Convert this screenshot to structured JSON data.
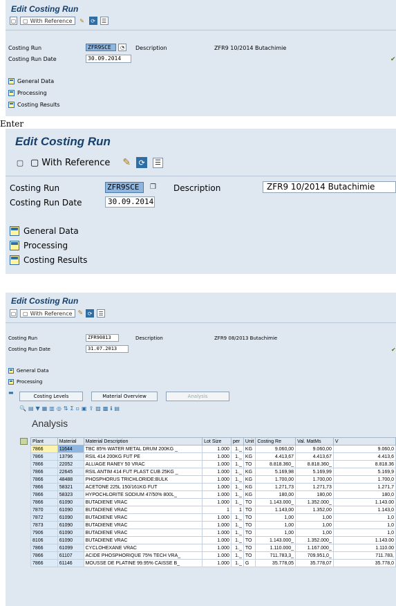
{
  "p1": {
    "title": "Edit Costing Run",
    "tb_ref": "With Reference",
    "run_lbl": "Costing Run",
    "run_val": "ZFR9SCE",
    "desc_lbl": "Description",
    "desc_val": "ZFR9 10/2014 Butachimie",
    "date_lbl": "Costing Run Date",
    "date_val": "30.09.2014",
    "sections": [
      "General Data",
      "Processing",
      "Costing Results"
    ]
  },
  "enter": "Enter",
  "p2": {
    "title": "Edit Costing Run",
    "tb_ref": "With Reference",
    "run_lbl": "Costing Run",
    "run_val": "ZFR9SCE",
    "desc_lbl": "Description",
    "desc_val": "ZFR9 10/2014 Butachimie",
    "date_lbl": "Costing Run Date",
    "date_val": "30.09.2014",
    "sections": [
      "General Data",
      "Processing",
      "Costing Results"
    ]
  },
  "p3": {
    "title": "Edit Costing Run",
    "tb_ref": "With Reference",
    "run_lbl": "Costing Run",
    "run_val": "ZFR90813",
    "desc_lbl": "Description",
    "desc_val": "ZFR9 08/2013 Butachimie",
    "date_lbl": "Costing Run Date",
    "date_val": "31.07.2013",
    "sections": [
      "General Data",
      "Processing"
    ],
    "tabs": [
      "Costing Levels",
      "Material Overview",
      "Analysis"
    ],
    "analysis_title": "Analysis",
    "columns": [
      "Plant",
      "Material",
      "Material Description",
      "Lot Size",
      "per",
      "Unit",
      "Costing Re",
      "Val. MatMs",
      "V"
    ],
    "rows": [
      [
        "7866",
        "11644",
        "TBC 85% WATER METAL DRUM 200KG _",
        "1.000",
        "1._",
        "KG",
        "9.060,00",
        "9.060,00",
        "9.060,0"
      ],
      [
        "7866",
        "13796",
        "RSIL 414 200KG FUT PE",
        "1.000",
        "1._",
        "KG",
        "4.413,67",
        "4.413,67",
        "4.413,6"
      ],
      [
        "7866",
        "22052",
        "ALLIAGE RANEY 50 VRAC",
        "1.000",
        "1._",
        "TO",
        "8.818.360_",
        "8.818.360_",
        "8.818.36"
      ],
      [
        "7866",
        "22645",
        "RSIL ANTIM 414 FUT PLAST CUB 25KG _",
        "1.000",
        "1._",
        "KG",
        "5.169,98",
        "5.169,99",
        "5.169,9"
      ],
      [
        "7866",
        "48488",
        "PHOSPHORUS TRICHLORIDE:BULK",
        "1.000",
        "1._",
        "KG",
        "1.700,00",
        "1.700,00",
        "1.700,0"
      ],
      [
        "7866",
        "58321",
        "ACETONE 225L 150/161KG FUT",
        "1.000",
        "1._",
        "KG",
        "1.271,73",
        "1.271,73",
        "1.271,7"
      ],
      [
        "7866",
        "58323",
        "HYPOCHLORITE SODIUM 47/50% 800L_",
        "1.000",
        "1._",
        "KG",
        "180,00",
        "180,00",
        "180,0"
      ],
      [
        "7866",
        "61090",
        "BUTADIENE VRAC",
        "1.000",
        "1._",
        "TO",
        "1.143.000_",
        "1.352.000_",
        "1.143.00"
      ],
      [
        "7870",
        "61090",
        "BUTADIENE VRAC",
        "1",
        "1",
        "TO",
        "1.143,00",
        "1.352,00",
        "1.143,0"
      ],
      [
        "7872",
        "61090",
        "BUTADIENE VRAC",
        "1.000",
        "1._",
        "TO",
        "1,00",
        "1,00",
        "1,0"
      ],
      [
        "7873",
        "61090",
        "BUTADIENE VRAC",
        "1.000",
        "1._",
        "TO",
        "1,00",
        "1,00",
        "1,0"
      ],
      [
        "7906",
        "61090",
        "BUTADIENE VRAC",
        "1.000",
        "1._",
        "TO",
        "1,00",
        "1,00",
        "1,0"
      ],
      [
        "8106",
        "61090",
        "BUTADIENE VRAC",
        "1.000",
        "1._",
        "TO",
        "1.143.000_",
        "1.352.000_",
        "1.143.00"
      ],
      [
        "7866",
        "61099",
        "CYCLOHEXANE VRAC",
        "1.000",
        "1._",
        "TO",
        "1.110.000_",
        "1.167.000_",
        "1.110.00"
      ],
      [
        "7866",
        "61107",
        "ACIDE PHOSPHORIQUE 75% TECH VRA_",
        "1.000",
        "1._",
        "TO",
        "711.783,3_",
        "709.951,0_",
        "711.783,"
      ],
      [
        "7866",
        "61146",
        "MOUSSE DE PLATINE 99.95% CAISSE B_",
        "1.000",
        "1._",
        "G",
        "35.778,05",
        "35.778,07",
        "35.778,0"
      ]
    ]
  }
}
